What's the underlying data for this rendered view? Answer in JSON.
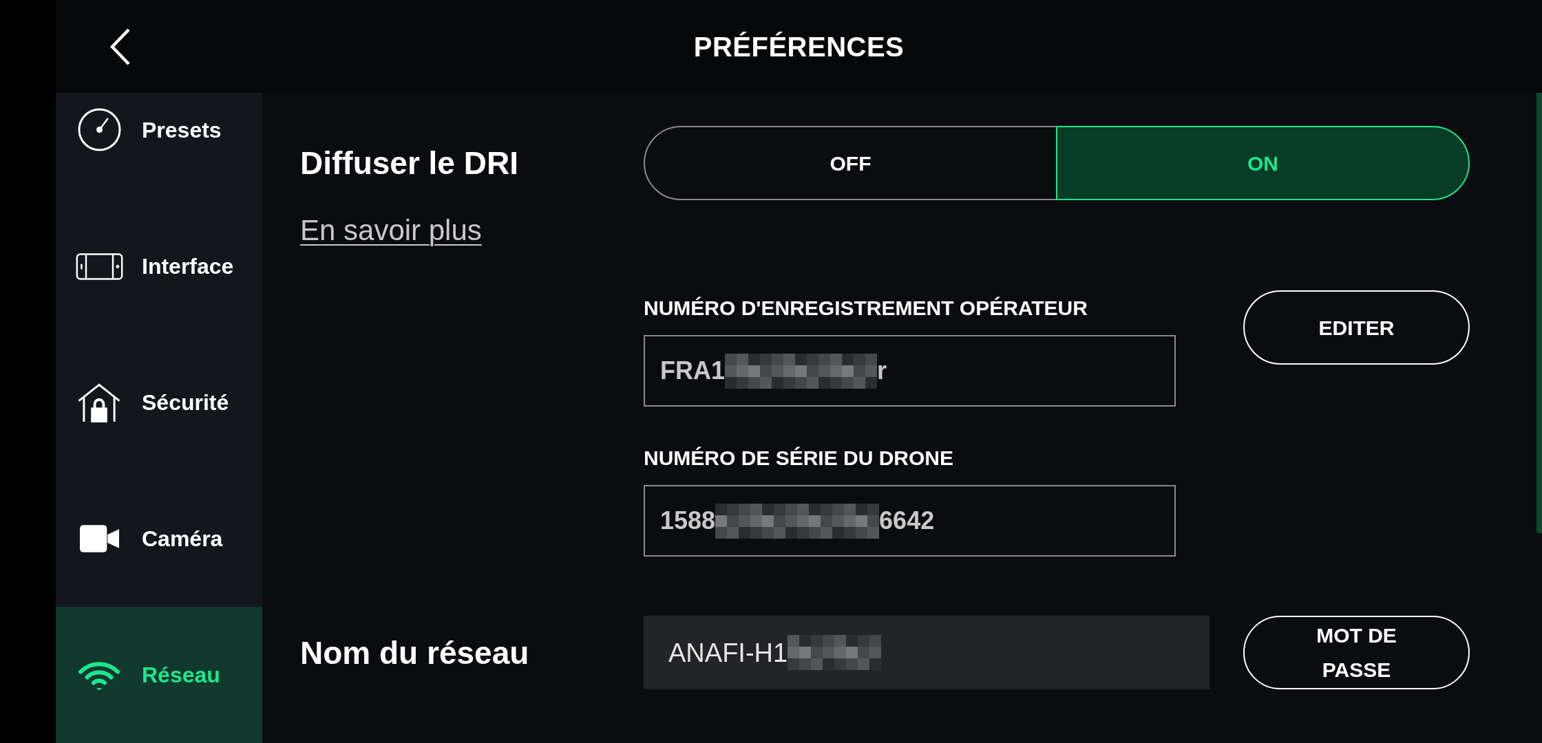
{
  "header": {
    "title": "PRÉFÉRENCES"
  },
  "sidebar": {
    "items": [
      {
        "label": "Presets",
        "selected": false
      },
      {
        "label": "Interface",
        "selected": false
      },
      {
        "label": "Sécurité",
        "selected": false
      },
      {
        "label": "Caméra",
        "selected": false
      },
      {
        "label": "Réseau",
        "selected": true
      }
    ]
  },
  "broadcast": {
    "label": "Diffuser le DRI",
    "link": "En savoir plus",
    "options": [
      {
        "label": "OFF",
        "selected": false
      },
      {
        "label": "ON",
        "selected": true
      }
    ]
  },
  "operator_registration": {
    "label": "NUMÉRO D'ENREGISTREMENT OPÉRATEUR",
    "value_parts": [
      {
        "kind": "text",
        "text": "FRA1"
      },
      {
        "kind": "redacted"
      },
      {
        "kind": "text",
        "text": "r"
      }
    ],
    "button": "EDITER"
  },
  "drone_serial": {
    "label": "NUMÉRO DE SÉRIE DU DRONE",
    "value_parts": [
      {
        "kind": "text",
        "text": "1588"
      },
      {
        "kind": "redacted"
      },
      {
        "kind": "text",
        "text": "6642"
      }
    ]
  },
  "network": {
    "label": "Nom du réseau",
    "value_parts": [
      {
        "kind": "text",
        "text": "ANAFI-H1"
      },
      {
        "kind": "redacted"
      }
    ],
    "button": "MOT DE PASSE"
  }
}
